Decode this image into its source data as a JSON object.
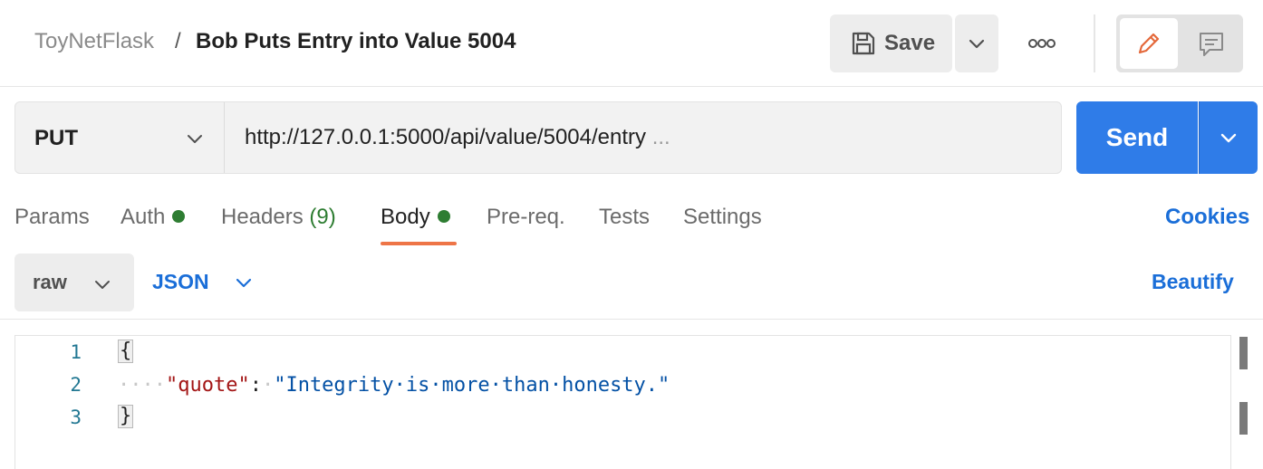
{
  "header": {
    "collection_name": "ToyNetFlask",
    "separator": "/",
    "request_name": "Bob Puts Entry into Value 5004",
    "save_label": "Save",
    "more_label": "ooo"
  },
  "request": {
    "method": "PUT",
    "url": "http://127.0.0.1:5000/api/value/5004/entry",
    "url_overflow": "...",
    "send_label": "Send"
  },
  "tabs": {
    "params": "Params",
    "auth": "Auth",
    "headers": "Headers",
    "headers_count": "(9)",
    "body": "Body",
    "prereq": "Pre-req.",
    "tests": "Tests",
    "settings": "Settings",
    "cookies": "Cookies",
    "active": "Body"
  },
  "body_options": {
    "mode": "raw",
    "language": "JSON",
    "beautify": "Beautify"
  },
  "editor": {
    "line_numbers": [
      "1",
      "2",
      "3"
    ],
    "open_brace": "{",
    "indent": "····",
    "key": "\"quote\"",
    "colon": ":",
    "value": "\"Integrity·is·more·than·honesty.\"",
    "close_brace": "}"
  },
  "colors": {
    "accent_blue": "#2f7ce8",
    "active_tab_underline": "#ee7547",
    "status_dot_green": "#2e7d32",
    "link_blue": "#1a6ed8"
  },
  "icons": {
    "save": "floppy-disk-icon",
    "more": "more-horizontal-icon",
    "edit": "pencil-icon",
    "comments": "comment-icon",
    "dropdown": "chevron-down-icon"
  }
}
